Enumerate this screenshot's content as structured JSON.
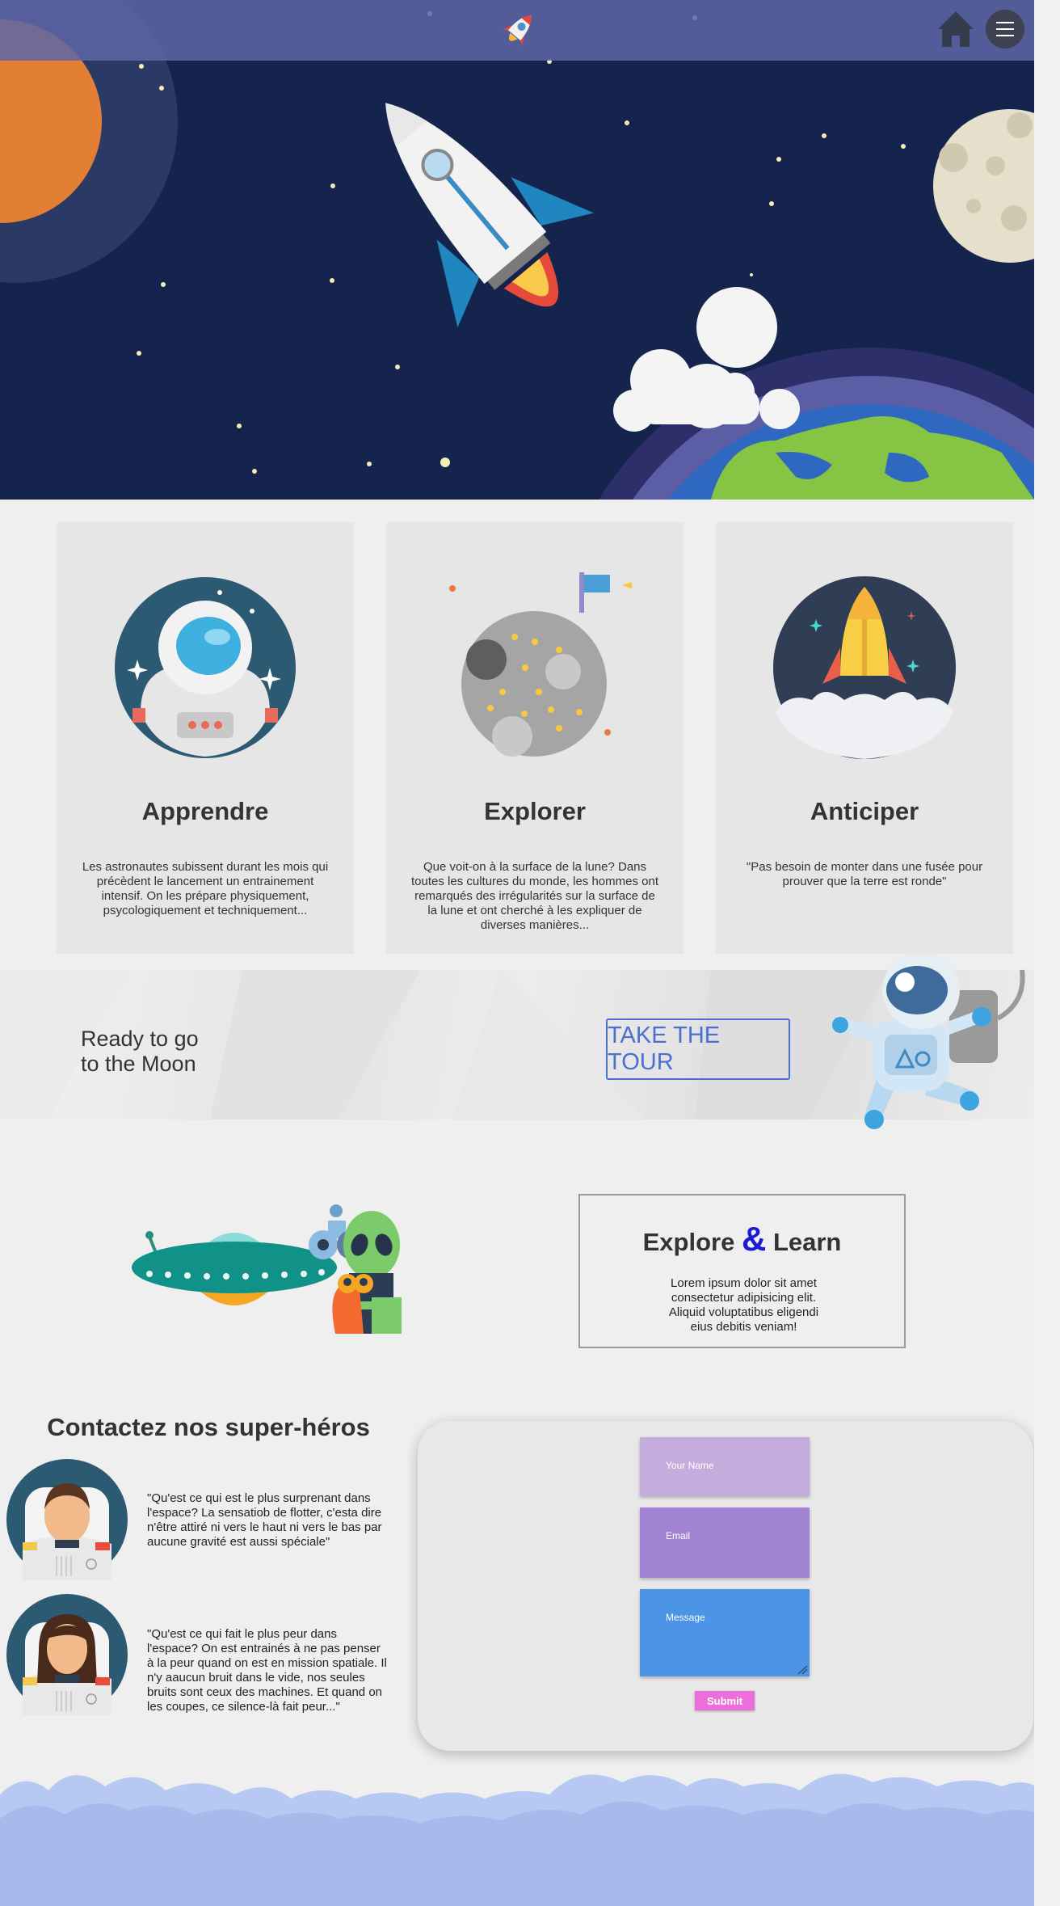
{
  "nav": {
    "logo_icon": "rocket-icon",
    "home_icon": "home-icon",
    "menu_icon": "hamburger-menu-icon"
  },
  "cards": [
    {
      "title": "Apprendre",
      "text": "Les astronautes subissent durant les mois qui précèdent le lancement un entrainement intensif. On les prépare physiquement, psycologiquement et techniquement...",
      "icon": "astronaut-helmet-icon"
    },
    {
      "title": "Explorer",
      "text": "Que voit-on à la surface de la lune? Dans toutes les cultures du monde, les hommes ont remarqués des irrégularités sur la surface de la lune et ont cherché à les expliquer de diverses manières...",
      "icon": "moon-flag-icon"
    },
    {
      "title": "Anticiper",
      "text": "\"Pas besoin de monter dans une fusée pour prouver que la terre est ronde\"",
      "icon": "rocket-launch-icon"
    }
  ],
  "band": {
    "line1": "Ready to go",
    "line2": "to the Moon",
    "button": "TAKE THE TOUR"
  },
  "explore": {
    "title_part1": "Explore",
    "amp": "&",
    "title_part2": "Learn",
    "text": "Lorem ipsum dolor sit amet consectetur adipisicing elit. Aliquid voluptatibus eligendi eius debitis veniam!"
  },
  "contact": {
    "title": "Contactez nos super-héros",
    "quotes": [
      "\"Qu'est ce qui est le plus surprenant dans l'espace? La sensatiob de flotter, c'esta dire n'être attiré ni vers le haut ni vers le bas par aucune gravité est aussi spéciale\"",
      "\"Qu'est ce qui fait le plus peur dans l'espace? On est entrainés à ne pas penser à la peur quand on est en mission spatiale. Il n'y aaucun bruit dans le vide, nos seules bruits sont ceux des machines. Et quand on les coupes, ce silence-là fait peur...\""
    ],
    "form": {
      "name_placeholder": "Your Name",
      "email_placeholder": "Email",
      "message_placeholder": "Message",
      "submit": "Submit"
    }
  },
  "colors": {
    "hero_bg": "#15244c",
    "topbar": "#5c66a6",
    "accent_blue": "#4b6fd0",
    "name_field": "#c4acdc",
    "email_field": "#a283d4",
    "message_field": "#4c94e6",
    "submit": "#ec6ed8"
  }
}
